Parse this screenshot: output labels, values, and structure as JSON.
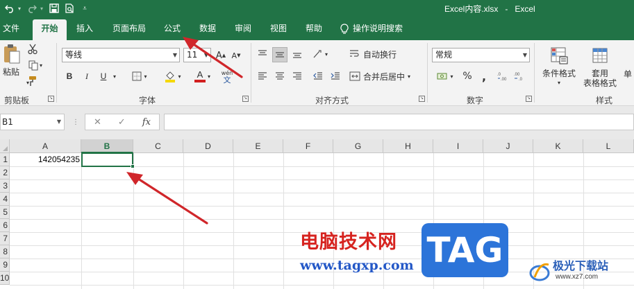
{
  "titlebar": {
    "file_name": "Excel内容.xlsx",
    "separator": "-",
    "app_name": "Excel",
    "qat": {
      "undo_icon": "undo-icon",
      "redo_icon": "redo-icon",
      "save_icon": "save-icon",
      "print_preview_icon": "print-preview-icon",
      "customize_icon": "customize-qat-icon"
    }
  },
  "tabs": [
    {
      "label": "文件"
    },
    {
      "label": "开始",
      "active": true
    },
    {
      "label": "插入"
    },
    {
      "label": "页面布局"
    },
    {
      "label": "公式"
    },
    {
      "label": "数据"
    },
    {
      "label": "审阅"
    },
    {
      "label": "视图"
    },
    {
      "label": "帮助"
    },
    {
      "label": "操作说明搜索"
    }
  ],
  "ribbon": {
    "clipboard": {
      "paste_label": "粘贴",
      "group_label": "剪贴板"
    },
    "font": {
      "font_name": "等线",
      "font_size": "11",
      "bold": "B",
      "italic": "I",
      "underline": "U",
      "increase_font": "A",
      "decrease_font": "A",
      "font_color_letter": "A",
      "phonetic_top": "wén",
      "phonetic_bottom": "文",
      "group_label": "字体"
    },
    "alignment": {
      "wrap_text": "自动换行",
      "merge_center": "合并后居中",
      "group_label": "对齐方式"
    },
    "number": {
      "format": "常规",
      "percent": "%",
      "comma": ",",
      "group_label": "数字"
    },
    "styles": {
      "conditional_format": "条件格式",
      "table_format_line1": "套用",
      "table_format_line2": "表格格式",
      "cell_styles_partial": "单",
      "group_label": "样式"
    },
    "colors": {
      "fill_color": "#f5d800",
      "font_color": "#d21f1f"
    }
  },
  "formula_bar": {
    "name_box": "B1",
    "cancel": "✕",
    "enter": "✓",
    "fx": "fx",
    "formula": ""
  },
  "grid": {
    "columns": [
      "A",
      "B",
      "C",
      "D",
      "E",
      "F",
      "G",
      "H",
      "I",
      "J",
      "K",
      "L"
    ],
    "selected_column": "B",
    "rows": [
      "1",
      "2",
      "3",
      "4",
      "5",
      "6",
      "7",
      "8",
      "9",
      "10"
    ],
    "cells": {
      "A1": "142054235",
      "B1": ""
    },
    "active_cell": "B1"
  },
  "watermark": {
    "site_cn": "电脑技术网",
    "site_url": "www.tagxp.com",
    "tag": "TAG",
    "logo_cn": "极光下载站",
    "logo_url": "www.xz7.com"
  },
  "colors": {
    "excel_green": "#217346",
    "annotation_arrow": "#d0262a"
  }
}
